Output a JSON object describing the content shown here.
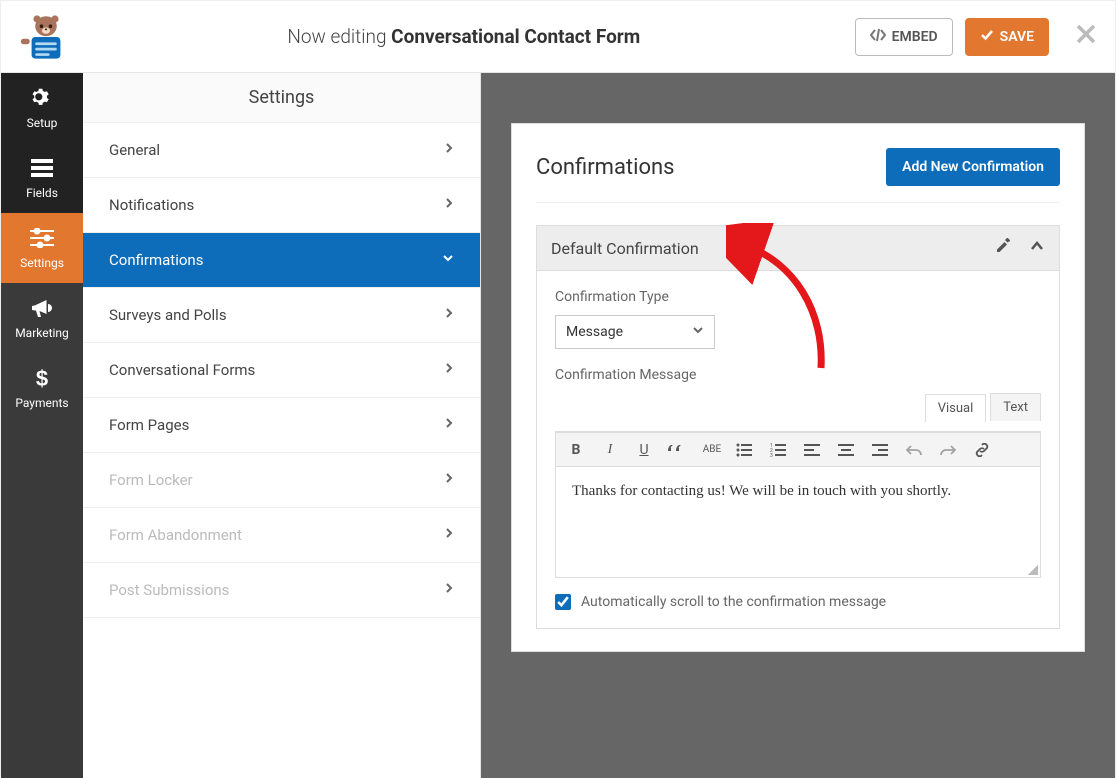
{
  "header": {
    "editing_prefix": "Now editing",
    "form_name": "Conversational Contact Form",
    "embed_label": "EMBED",
    "save_label": "SAVE"
  },
  "leftnav": {
    "setup": "Setup",
    "fields": "Fields",
    "settings": "Settings",
    "marketing": "Marketing",
    "payments": "Payments"
  },
  "panel": {
    "title": "Settings",
    "items": [
      {
        "label": "General",
        "active": false,
        "disabled": false
      },
      {
        "label": "Notifications",
        "active": false,
        "disabled": false
      },
      {
        "label": "Confirmations",
        "active": true,
        "disabled": false
      },
      {
        "label": "Surveys and Polls",
        "active": false,
        "disabled": false
      },
      {
        "label": "Conversational Forms",
        "active": false,
        "disabled": false
      },
      {
        "label": "Form Pages",
        "active": false,
        "disabled": false
      },
      {
        "label": "Form Locker",
        "active": false,
        "disabled": true
      },
      {
        "label": "Form Abandonment",
        "active": false,
        "disabled": true
      },
      {
        "label": "Post Submissions",
        "active": false,
        "disabled": true
      }
    ]
  },
  "main": {
    "heading": "Confirmations",
    "add_btn": "Add New Confirmation",
    "accordion_title": "Default Confirmation",
    "type_label": "Confirmation Type",
    "type_value": "Message",
    "message_label": "Confirmation Message",
    "tabs": {
      "visual": "Visual",
      "text": "Text"
    },
    "editor_content": "Thanks for contacting us! We will be in touch with you shortly.",
    "auto_scroll_label": "Automatically scroll to the confirmation message",
    "auto_scroll_checked": true
  }
}
